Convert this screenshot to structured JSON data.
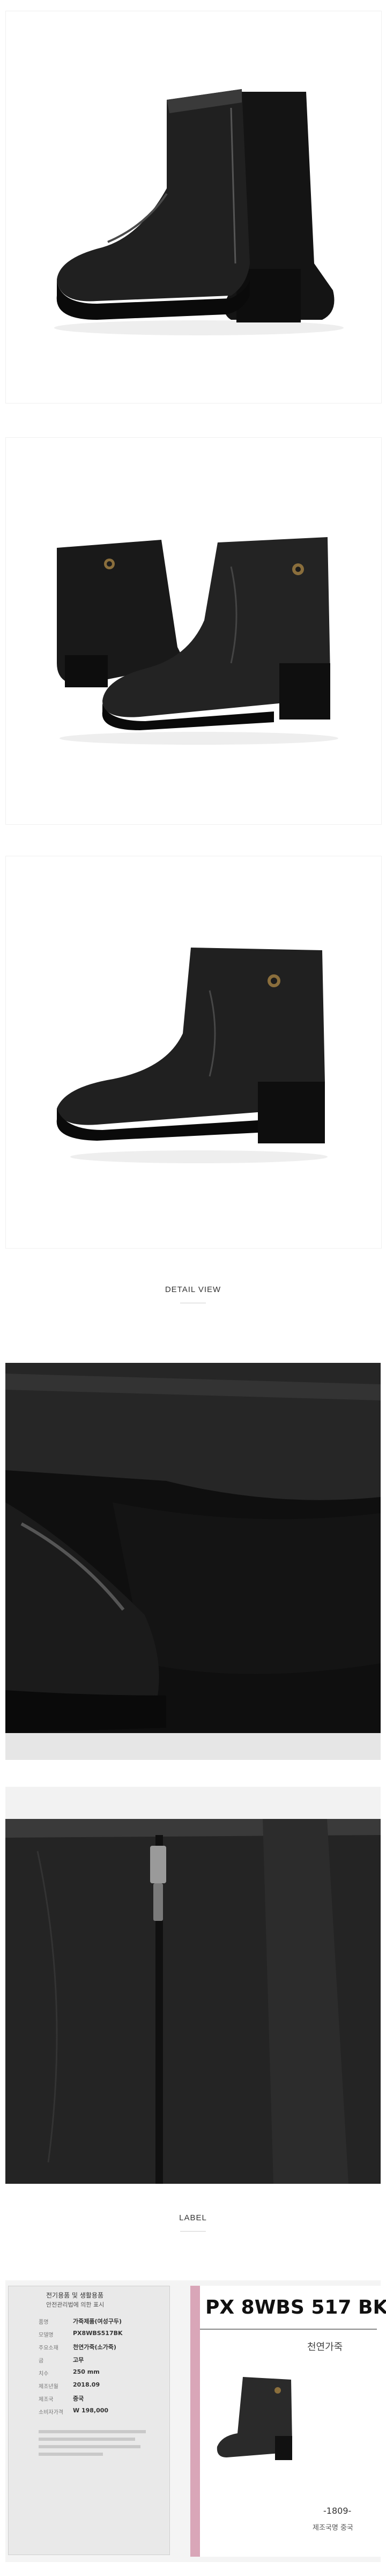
{
  "sections": {
    "detail_title": "DETAIL VIEW",
    "label_title": "LABEL"
  },
  "label": {
    "header_line1": "전기용품 및 생활용품",
    "header_line2": "안전관리법에 의한 표시",
    "rows": [
      {
        "key": "품명",
        "value": "가죽제품(여성구두)"
      },
      {
        "key": "모델명",
        "value": "PX8WBS517BK"
      },
      {
        "key": "주요소재",
        "value": "천연가죽(소가죽)"
      },
      {
        "key": "굽",
        "value": "고무"
      },
      {
        "key": "치수",
        "value": "250 mm"
      },
      {
        "key": "제조년월",
        "value": "2018.09"
      },
      {
        "key": "제조국",
        "value": "중국"
      },
      {
        "key": "소비자가격",
        "value": "W 198,000"
      }
    ],
    "tag_code": "PX 8WBS 517 BK",
    "tag_material": "천연가죽",
    "tag_date": "-1809-",
    "tag_country": "제조국명 중국"
  },
  "colors": {
    "leather": "#1c1c1c",
    "leather_highlight": "#4a4a4a",
    "label_pink": "#d9a6b8",
    "background": "#ffffff"
  }
}
